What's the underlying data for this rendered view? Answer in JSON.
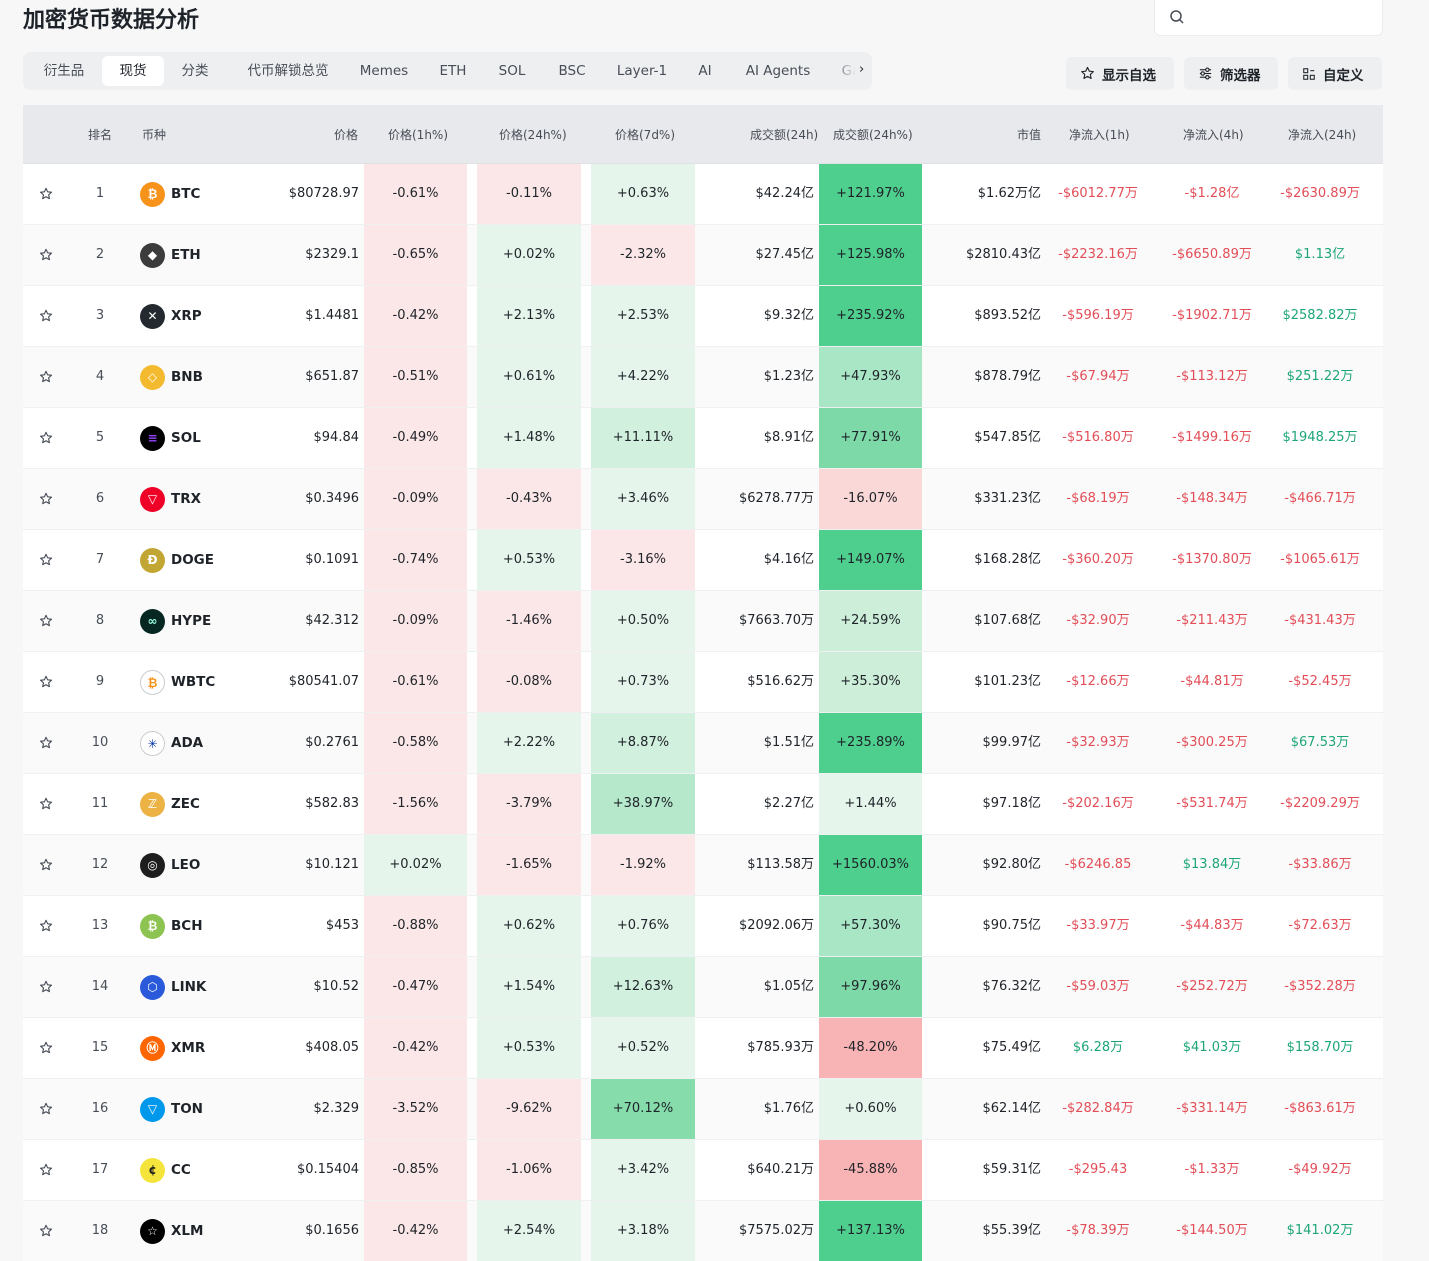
{
  "page": {
    "title": "加密货币数据分析"
  },
  "search": {
    "placeholder": ""
  },
  "tabs": [
    "衍生品",
    "现货",
    "分类",
    "代币解锁总览",
    "Memes",
    "ETH",
    "SOL",
    "BSC",
    "Layer-1",
    "AI",
    "AI Agents",
    "Ga"
  ],
  "active_tab": "现货",
  "tools": {
    "watchlist": "显示自选",
    "filter": "筛选器",
    "customize": "自定义"
  },
  "columns": {
    "rank": "排名",
    "coin": "币种",
    "price": "价格",
    "p1h": "价格(1h%)",
    "p24h": "价格(24h%)",
    "p7d": "价格(7d%)",
    "vol": "成交额(24h)",
    "vol_pct": "成交额(24h%)",
    "mcap": "市值",
    "flow1h": "净流入(1h)",
    "flow4h": "净流入(4h)",
    "flow24h": "净流入(24h)"
  },
  "colors": {
    "up": "#1da57a",
    "down": "#e24d57",
    "up_bg": "#e6f5ec",
    "down_bg": "#fbe7e7"
  },
  "rows": [
    {
      "rank": "1",
      "sym": "BTC",
      "icon": "btc-logo",
      "color": "#f7931a",
      "price": "$80728.97",
      "p1h": "-0.61%",
      "p24h": "-0.11%",
      "p7d": "+0.63%",
      "vol": "$42.24亿",
      "vol_pct": "+121.97%",
      "mcap": "$1.62万亿",
      "f1h": "-$6012.77万",
      "f4h": "-$1.28亿",
      "f24h": "-$2630.89万"
    },
    {
      "rank": "2",
      "sym": "ETH",
      "icon": "eth-logo",
      "color": "#3c3c3d",
      "price": "$2329.1",
      "p1h": "-0.65%",
      "p24h": "+0.02%",
      "p7d": "-2.32%",
      "vol": "$27.45亿",
      "vol_pct": "+125.98%",
      "mcap": "$2810.43亿",
      "f1h": "-$2232.16万",
      "f4h": "-$6650.89万",
      "f24h": "$1.13亿"
    },
    {
      "rank": "3",
      "sym": "XRP",
      "icon": "xrp-logo",
      "color": "#23292f",
      "price": "$1.4481",
      "p1h": "-0.42%",
      "p24h": "+2.13%",
      "p7d": "+2.53%",
      "vol": "$9.32亿",
      "vol_pct": "+235.92%",
      "mcap": "$893.52亿",
      "f1h": "-$596.19万",
      "f4h": "-$1902.71万",
      "f24h": "$2582.82万"
    },
    {
      "rank": "4",
      "sym": "BNB",
      "icon": "bnb-logo",
      "color": "#f3ba2f",
      "price": "$651.87",
      "p1h": "-0.51%",
      "p24h": "+0.61%",
      "p7d": "+4.22%",
      "vol": "$1.23亿",
      "vol_pct": "+47.93%",
      "mcap": "$878.79亿",
      "f1h": "-$67.94万",
      "f4h": "-$113.12万",
      "f24h": "$251.22万"
    },
    {
      "rank": "5",
      "sym": "SOL",
      "icon": "sol-logo",
      "color": "#000000",
      "price": "$94.84",
      "p1h": "-0.49%",
      "p24h": "+1.48%",
      "p7d": "+11.11%",
      "vol": "$8.91亿",
      "vol_pct": "+77.91%",
      "mcap": "$547.85亿",
      "f1h": "-$516.80万",
      "f4h": "-$1499.16万",
      "f24h": "$1948.25万"
    },
    {
      "rank": "6",
      "sym": "TRX",
      "icon": "trx-logo",
      "color": "#ef0027",
      "price": "$0.3496",
      "p1h": "-0.09%",
      "p24h": "-0.43%",
      "p7d": "+3.46%",
      "vol": "$6278.77万",
      "vol_pct": "-16.07%",
      "mcap": "$331.23亿",
      "f1h": "-$68.19万",
      "f4h": "-$148.34万",
      "f24h": "-$466.71万"
    },
    {
      "rank": "7",
      "sym": "DOGE",
      "icon": "doge-logo",
      "color": "#c2a633",
      "price": "$0.1091",
      "p1h": "-0.74%",
      "p24h": "+0.53%",
      "p7d": "-3.16%",
      "vol": "$4.16亿",
      "vol_pct": "+149.07%",
      "mcap": "$168.28亿",
      "f1h": "-$360.20万",
      "f4h": "-$1370.80万",
      "f24h": "-$1065.61万"
    },
    {
      "rank": "8",
      "sym": "HYPE",
      "icon": "hype-logo",
      "color": "#072723",
      "price": "$42.312",
      "p1h": "-0.09%",
      "p24h": "-1.46%",
      "p7d": "+0.50%",
      "vol": "$7663.70万",
      "vol_pct": "+24.59%",
      "mcap": "$107.68亿",
      "f1h": "-$32.90万",
      "f4h": "-$211.43万",
      "f24h": "-$431.43万"
    },
    {
      "rank": "9",
      "sym": "WBTC",
      "icon": "wbtc-logo",
      "color": "#ffffff",
      "price": "$80541.07",
      "p1h": "-0.61%",
      "p24h": "-0.08%",
      "p7d": "+0.73%",
      "vol": "$516.62万",
      "vol_pct": "+35.30%",
      "mcap": "$101.23亿",
      "f1h": "-$12.66万",
      "f4h": "-$44.81万",
      "f24h": "-$52.45万"
    },
    {
      "rank": "10",
      "sym": "ADA",
      "icon": "ada-logo",
      "color": "#ffffff",
      "price": "$0.2761",
      "p1h": "-0.58%",
      "p24h": "+2.22%",
      "p7d": "+8.87%",
      "vol": "$1.51亿",
      "vol_pct": "+235.89%",
      "mcap": "$99.97亿",
      "f1h": "-$32.93万",
      "f4h": "-$300.25万",
      "f24h": "$67.53万"
    },
    {
      "rank": "11",
      "sym": "ZEC",
      "icon": "zec-logo",
      "color": "#ecb244",
      "price": "$582.83",
      "p1h": "-1.56%",
      "p24h": "-3.79%",
      "p7d": "+38.97%",
      "vol": "$2.27亿",
      "vol_pct": "+1.44%",
      "mcap": "$97.18亿",
      "f1h": "-$202.16万",
      "f4h": "-$531.74万",
      "f24h": "-$2209.29万"
    },
    {
      "rank": "12",
      "sym": "LEO",
      "icon": "leo-logo",
      "color": "#1e1e1e",
      "price": "$10.121",
      "p1h": "+0.02%",
      "p24h": "-1.65%",
      "p7d": "-1.92%",
      "vol": "$113.58万",
      "vol_pct": "+1560.03%",
      "mcap": "$92.80亿",
      "f1h": "-$6246.85",
      "f4h": "$13.84万",
      "f24h": "-$33.86万"
    },
    {
      "rank": "13",
      "sym": "BCH",
      "icon": "bch-logo",
      "color": "#8dc351",
      "price": "$453",
      "p1h": "-0.88%",
      "p24h": "+0.62%",
      "p7d": "+0.76%",
      "vol": "$2092.06万",
      "vol_pct": "+57.30%",
      "mcap": "$90.75亿",
      "f1h": "-$33.97万",
      "f4h": "-$44.83万",
      "f24h": "-$72.63万"
    },
    {
      "rank": "14",
      "sym": "LINK",
      "icon": "link-logo",
      "color": "#2a5ada",
      "price": "$10.52",
      "p1h": "-0.47%",
      "p24h": "+1.54%",
      "p7d": "+12.63%",
      "vol": "$1.05亿",
      "vol_pct": "+97.96%",
      "mcap": "$76.32亿",
      "f1h": "-$59.03万",
      "f4h": "-$252.72万",
      "f24h": "-$352.28万"
    },
    {
      "rank": "15",
      "sym": "XMR",
      "icon": "xmr-logo",
      "color": "#ff6600",
      "price": "$408.05",
      "p1h": "-0.42%",
      "p24h": "+0.53%",
      "p7d": "+0.52%",
      "vol": "$785.93万",
      "vol_pct": "-48.20%",
      "mcap": "$75.49亿",
      "f1h": "$6.28万",
      "f4h": "$41.03万",
      "f24h": "$158.70万"
    },
    {
      "rank": "16",
      "sym": "TON",
      "icon": "ton-logo",
      "color": "#0098ea",
      "price": "$2.329",
      "p1h": "-3.52%",
      "p24h": "-9.62%",
      "p7d": "+70.12%",
      "vol": "$1.76亿",
      "vol_pct": "+0.60%",
      "mcap": "$62.14亿",
      "f1h": "-$282.84万",
      "f4h": "-$331.14万",
      "f24h": "-$863.61万"
    },
    {
      "rank": "17",
      "sym": "CC",
      "icon": "cc-logo",
      "color": "#f4e43c",
      "price": "$0.15404",
      "p1h": "-0.85%",
      "p24h": "-1.06%",
      "p7d": "+3.42%",
      "vol": "$640.21万",
      "vol_pct": "-45.88%",
      "mcap": "$59.31亿",
      "f1h": "-$295.43",
      "f4h": "-$1.33万",
      "f24h": "-$49.92万"
    },
    {
      "rank": "18",
      "sym": "XLM",
      "icon": "xlm-logo",
      "color": "#000000",
      "price": "$0.1656",
      "p1h": "-0.42%",
      "p24h": "+2.54%",
      "p7d": "+3.18%",
      "vol": "$7575.02万",
      "vol_pct": "+137.13%",
      "mcap": "$55.39亿",
      "f1h": "-$78.39万",
      "f4h": "-$144.50万",
      "f24h": "$141.02万"
    }
  ]
}
